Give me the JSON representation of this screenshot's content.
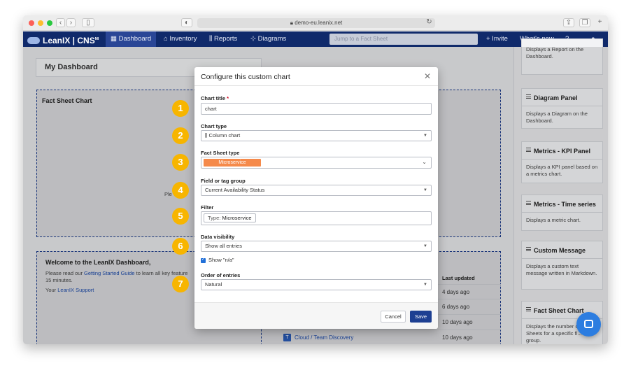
{
  "browser": {
    "url": "demo-eu.leanix.net"
  },
  "navbar": {
    "logo": "LeanIX | CNS",
    "items": [
      "Dashboard",
      "Inventory",
      "Reports",
      "Diagrams"
    ],
    "search_placeholder": "Jump to a Fact Sheet",
    "invite": "+ Invite",
    "whats_new": "What's new",
    "help": "?"
  },
  "dashboard": {
    "title": "My Dashboard",
    "fact_sheet_chart_title": "Fact Sheet Chart",
    "partial_text": "Ple",
    "welcome_title": "Welcome to the LeanIX Dashboard,",
    "welcome_text_1": "Please read our ",
    "welcome_link": "Getting Started Guide",
    "welcome_text_2": " to learn all key feature",
    "welcome_text_3": "15 minutes.",
    "support_prefix": "Your ",
    "support_link": "LeanIX Support",
    "list_header": "Last updated",
    "list_rows": [
      {
        "name": "",
        "updated": "4 days ago"
      },
      {
        "name": "",
        "updated": "6 days ago"
      },
      {
        "name": "",
        "updated": "10 days ago"
      },
      {
        "name": "Cloud / Team Discovery",
        "updated": "10 days ago",
        "type_letter": "T"
      }
    ]
  },
  "sidebar": {
    "top_partial": "Displays a Report on the Dashboard.",
    "widgets": [
      {
        "title": "Diagram Panel",
        "desc": "Displays a Diagram on the Dashboard."
      },
      {
        "title": "Metrics - KPI Panel",
        "desc": "Displays a KPI panel based on a metrics chart."
      },
      {
        "title": "Metrics - Time series",
        "desc": "Displays a metric chart."
      },
      {
        "title": "Custom Message",
        "desc": "Displays a custom text message written in Markdown."
      },
      {
        "title": "Fact Sheet Chart",
        "desc": "Displays the number of Fact Sheets for a specific fi... tag group."
      }
    ]
  },
  "modal": {
    "title": "Configure this custom chart",
    "chart_title_label": "Chart title",
    "chart_title_required": "*",
    "chart_title_value": "chart",
    "chart_type_label": "Chart type",
    "chart_type_value": "Column chart",
    "fact_sheet_type_label": "Fact Sheet type",
    "fact_sheet_type_value": "Microservice",
    "field_label": "Field or tag group",
    "field_value": "Current Availability Status",
    "filter_label": "Filter",
    "filter_chip_prefix": "Type: ",
    "filter_chip_value": "Microservice",
    "visibility_label": "Data visibility",
    "visibility_value": "Show all entries",
    "show_na_label": "Show \"n/a\"",
    "order_label": "Order of entries",
    "order_value": "Natural",
    "cancel": "Cancel",
    "save": "Save"
  },
  "badges": [
    "1",
    "2",
    "3",
    "4",
    "5",
    "6",
    "7"
  ],
  "colors": {
    "navbar": "#102a6b",
    "accent": "#1d3f92",
    "microservice_tag": "#f58a4b",
    "badge": "#f7b500"
  }
}
